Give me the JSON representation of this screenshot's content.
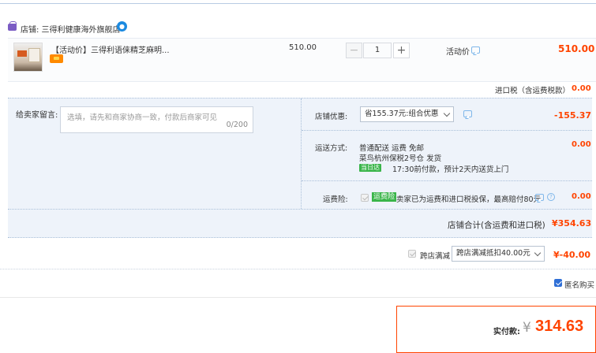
{
  "store": {
    "label": "店铺: 三得利健康海外旗舰店"
  },
  "item": {
    "title": "【活动价】三得利语俫精芝麻明...",
    "unit_price": "510.00",
    "quantity": "1",
    "promo_label": "活动价",
    "total": "510.00"
  },
  "import_tax": {
    "label": "进口税（含运费税款）",
    "value": "0.00"
  },
  "message": {
    "label": "给卖家留言:",
    "placeholder": "选填，请先和商家协商一致，付款后商家可见",
    "counter": "0/200"
  },
  "store_discount": {
    "label": "店铺优惠:",
    "selected": "省155.37元:组合优惠",
    "value": "-155.37"
  },
  "shipping": {
    "label": "运送方式:",
    "line1": "普通配送 运费 免邮",
    "line2": "菜鸟杭州保税2号仓   发货",
    "today_badge": "当日达",
    "line3": "17:30前付款，预计2天内送货上门",
    "value": "0.00"
  },
  "freight_insurance": {
    "label": "运费险:",
    "badge": "运费险",
    "text": "卖家已为运费和进口税投保，最高赔付80元",
    "value": "0.00"
  },
  "store_total": {
    "label": "店铺合计(含运费和进口税)",
    "value": "¥354.63"
  },
  "cross_store": {
    "checkbox_label": "跨店满减",
    "selected": "跨店满减抵扣40.00元",
    "value": "¥-40.00"
  },
  "anonymous": {
    "label": "匿名购买"
  },
  "payment": {
    "label": "实付款:",
    "currency": "¥",
    "value": "314.63"
  },
  "colors": {
    "accent_red": "#ff4400",
    "info_bg": "#eef3fa",
    "link_blue": "#1c8ae0"
  }
}
